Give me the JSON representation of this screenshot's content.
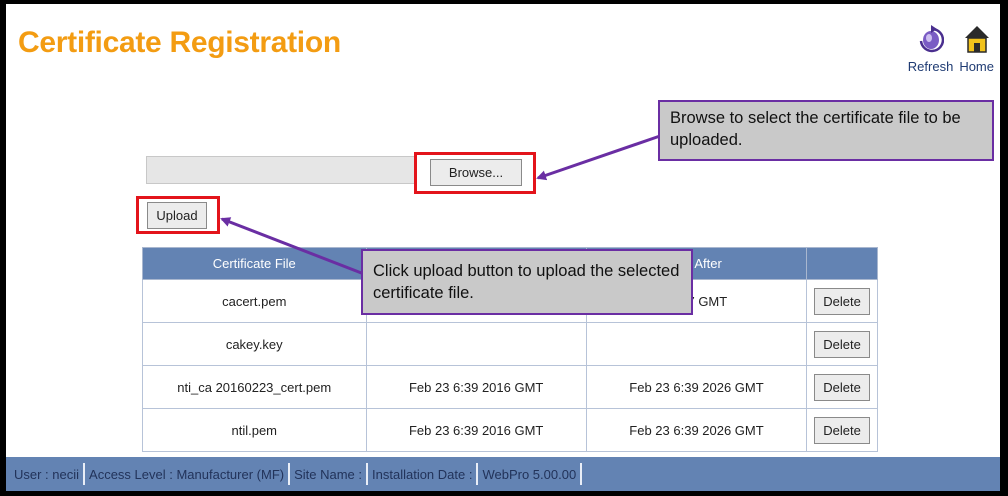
{
  "page": {
    "title": "Certificate Registration"
  },
  "nav": {
    "refresh_label": "Refresh",
    "home_label": "Home",
    "refresh_icon": "refresh-icon",
    "home_icon": "home-icon"
  },
  "upload_form": {
    "browse_label": "Browse...",
    "upload_label": "Upload",
    "file_value": ""
  },
  "callouts": {
    "browse": "Browse to select the certificate file to be uploaded.",
    "upload": "Click upload button to upload the selected  certificate file."
  },
  "table": {
    "columns": [
      "Certificate File",
      "",
      "Not After",
      ""
    ],
    "rows": [
      {
        "file": "cacert.pem",
        "not_before": "",
        "not_after": "2017 GMT",
        "action": "Delete"
      },
      {
        "file": "cakey.key",
        "not_before": "",
        "not_after": "",
        "action": "Delete"
      },
      {
        "file": "nti_ca 20160223_cert.pem",
        "not_before": "Feb 23 6:39 2016 GMT",
        "not_after": "Feb 23 6:39 2026 GMT",
        "action": "Delete"
      },
      {
        "file": "ntil.pem",
        "not_before": "Feb 23 6:39 2016 GMT",
        "not_after": "Feb 23 6:39 2026 GMT",
        "action": "Delete"
      }
    ]
  },
  "status": {
    "user": "User : necii",
    "access": "Access Level : Manufacturer (MF)",
    "site": "Site Name :",
    "install": "Installation Date :",
    "version": "WebPro 5.00.00"
  },
  "colors": {
    "title": "#f39c12",
    "header": "#6383b3",
    "highlight": "#e3141b",
    "callout_border": "#6a2ea3"
  }
}
